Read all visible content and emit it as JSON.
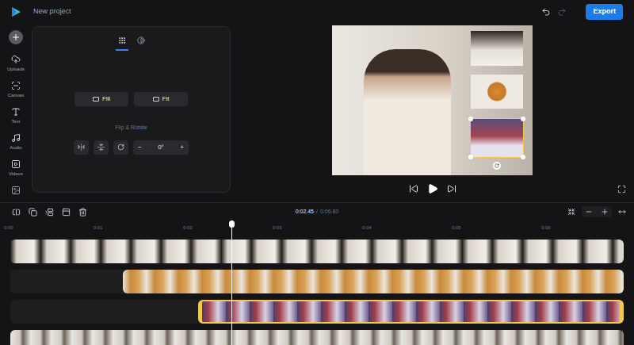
{
  "app": {
    "title": "New project",
    "export_button": "Export"
  },
  "sidebar": {
    "items": [
      {
        "label": "Uploads",
        "icon": "upload"
      },
      {
        "label": "Canvas",
        "icon": "canvas"
      },
      {
        "label": "Text",
        "icon": "text"
      },
      {
        "label": "Audio",
        "icon": "audio"
      },
      {
        "label": "Videos",
        "icon": "videos"
      }
    ]
  },
  "panel": {
    "tabs": [
      {
        "selected": true
      },
      {
        "selected": false
      }
    ],
    "fit_buttons": [
      "Fill",
      "Fit"
    ],
    "section_label": "Flip & Rotate",
    "rotation": {
      "decrease": "−",
      "value": "0°",
      "increase": "+"
    }
  },
  "timeline": {
    "current_time": "0:02.45",
    "separator": "/",
    "duration": "0:06.80",
    "ruler": [
      "0:00",
      "0:01",
      "0:02",
      "0:03",
      "0:04",
      "0:05",
      "0:06"
    ],
    "playhead": {
      "level": 0.36
    },
    "tracks": [
      {
        "kind": "book",
        "selected": false
      },
      {
        "kind": "coffee",
        "selected": false
      },
      {
        "kind": "shelf",
        "selected": true
      },
      {
        "kind": "main",
        "selected": false
      }
    ]
  }
}
